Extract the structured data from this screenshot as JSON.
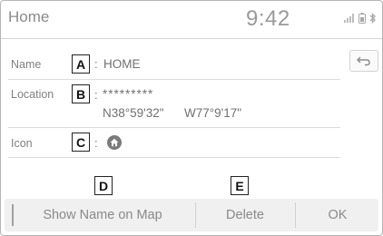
{
  "header": {
    "title": "Home",
    "clock": "9:42"
  },
  "status_icons": [
    "signal-icon",
    "battery-icon",
    "bluetooth-icon"
  ],
  "rows": {
    "name": {
      "label": "Name",
      "callout": "A",
      "value": "HOME"
    },
    "location": {
      "label": "Location",
      "callout": "B",
      "masked": "*********",
      "lat": "N38°59'32\"",
      "lon": "W77°9'17\""
    },
    "icon": {
      "label": "Icon",
      "callout": "C",
      "icon_name": "home-icon"
    }
  },
  "back_button": {
    "icon_name": "back-arrow-icon"
  },
  "buttons": {
    "show_name": {
      "label": "Show Name on Map",
      "callout": "D"
    },
    "delete": {
      "label": "Delete",
      "callout": "E"
    },
    "ok": {
      "label": "OK"
    }
  },
  "colors": {
    "background": "#ffffff",
    "text": "#707070",
    "button_bar": "#f0f0f0"
  }
}
